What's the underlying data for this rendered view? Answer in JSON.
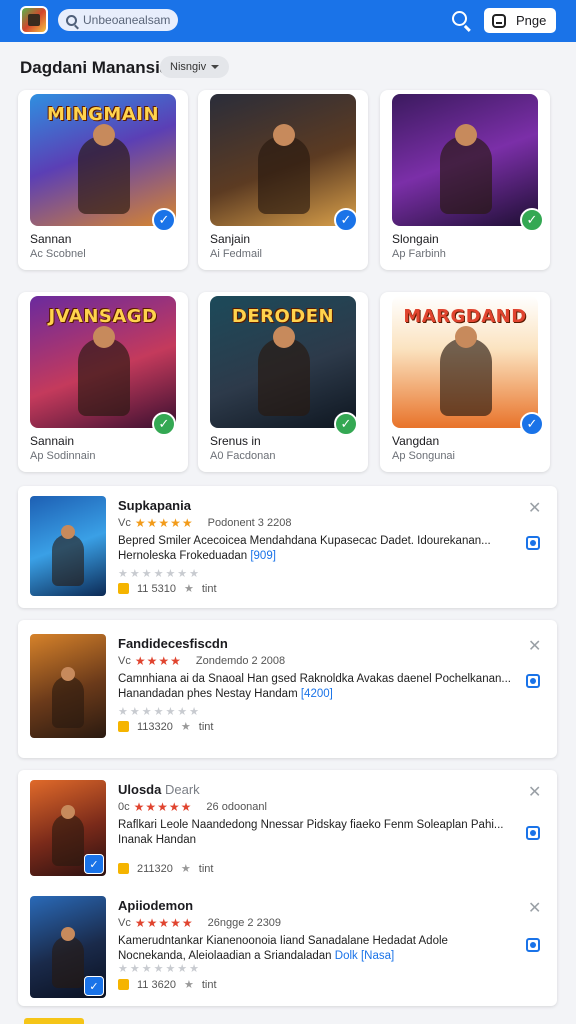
{
  "header": {
    "search_placeholder": "Unbeoanealsam",
    "page_button": "Pnge"
  },
  "section": {
    "title": "Dagdani Manansiai",
    "filter": "Nisngiv"
  },
  "grid": [
    {
      "name": "Sannan",
      "sub": "Ac Scobnel",
      "art_title": "MINGMAIN",
      "badge": "blue"
    },
    {
      "name": "Sanjain",
      "sub": "Ai Fedmail",
      "art_title": "",
      "badge": "blue"
    },
    {
      "name": "Slongain",
      "sub": "Ap Farbinh",
      "art_title": "",
      "badge": "green"
    },
    {
      "name": "Sannain",
      "sub": "Ap Sodinnain",
      "art_title": "JVANSAGD",
      "badge": "green"
    },
    {
      "name": "Srenus in",
      "sub": "A0 Facdonan",
      "art_title": "DERODEN",
      "badge": "green"
    },
    {
      "name": "Vangdan",
      "sub": "Ap Songunai",
      "art_title": "MARGDAND",
      "badge": "blue"
    }
  ],
  "list": [
    {
      "title": "Supkapania",
      "title_suffix": "",
      "meta_prefix": "Vc",
      "date": "Podonent 3 2208",
      "desc": "Bepred Smiler Acecoicea Mendahdana Kupasecac Dadet. Idourekanan... Hernoleska Frokeduadan",
      "link": "[909]",
      "downloads": "11 5310",
      "likes": "tint"
    },
    {
      "title": "Fandidecesfiscdn",
      "title_suffix": "",
      "meta_prefix": "Vc",
      "date": "Zondemdo 2 2008",
      "desc": "Camnhiana ai da Snaoal Han gsed Raknoldka Avakas daenel Pochelkanan... Hanandadan phes Nestay Handam",
      "link": "[4200]",
      "downloads": "113320",
      "likes": "tint"
    },
    {
      "title": "Ulosda",
      "title_suffix": "Deark",
      "meta_prefix": "0c",
      "date": "26 odoonanl",
      "desc": "Raflkari Leole Naandedong Nnessar Pidskay fiaeko Fenm Soleaplan Pahi... Inanak Handan",
      "link": "",
      "downloads": "211320",
      "likes": "tint"
    },
    {
      "title": "Apiiodemon",
      "title_suffix": "",
      "meta_prefix": "Vc",
      "date": "26ngge 2 2309",
      "desc": "Kamerudntankar Kianenoonoia Iiand Sanadalane Hedadat Adole Nocnekanda, Aleiolaadian a Sriandaladan",
      "link": "Dolk [Nasa]",
      "downloads": "11 3620",
      "likes": "tint"
    }
  ],
  "colors": {
    "header": "#1a73e8",
    "badge_blue": "#1a73e8",
    "badge_green": "#34a853",
    "star": "#f29b1a"
  }
}
